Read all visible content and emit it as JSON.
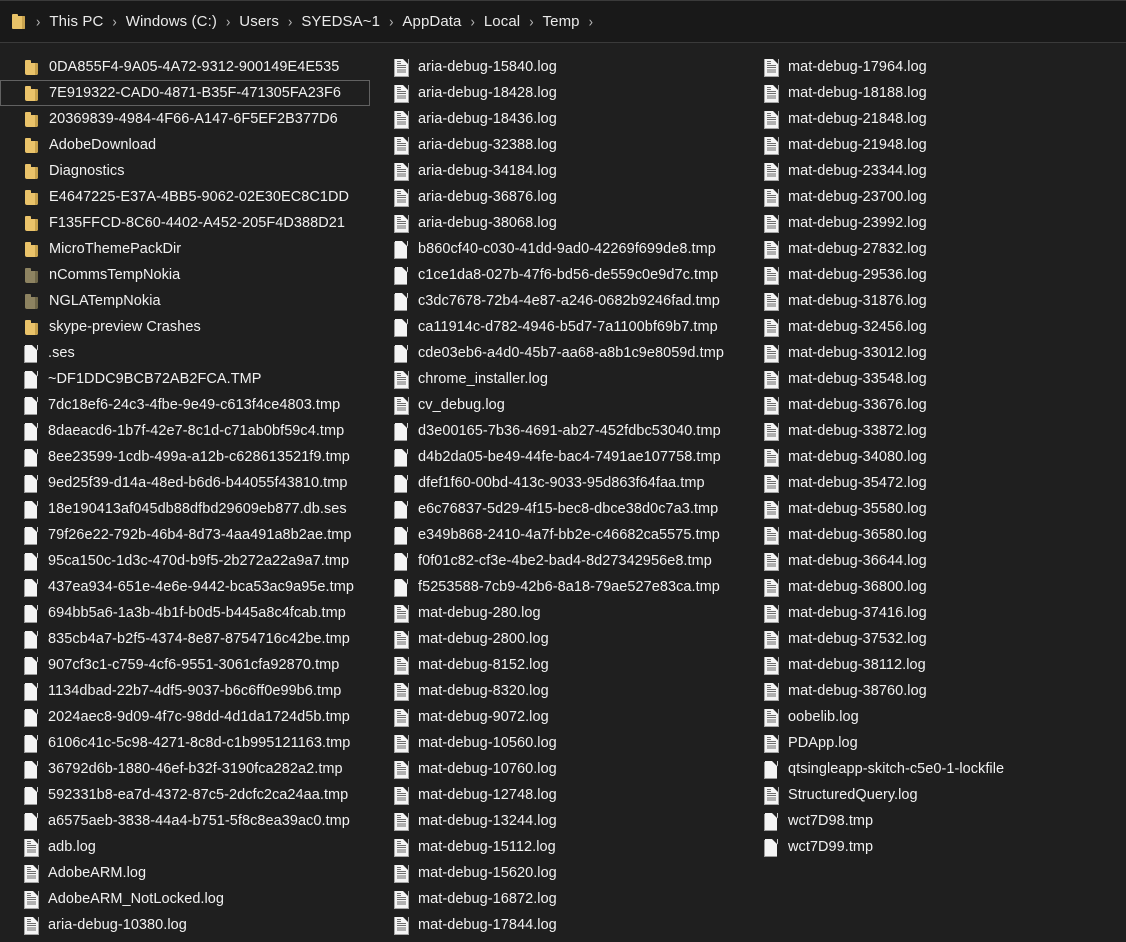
{
  "window": {
    "title": "Temp"
  },
  "addressbar": {
    "folder_icon": "folder-icon",
    "separator": "›",
    "crumbs": [
      "This PC",
      "Windows (C:)",
      "Users",
      "SYEDSA~1",
      "AppData",
      "Local",
      "Temp"
    ]
  },
  "colors": {
    "background": "#1f1f1f",
    "addressbar_background": "#191919",
    "text": "#f2f2f2",
    "folder_icon": "#eac36a",
    "folder_icon_dim": "#8d8361",
    "selection_border": "#616161",
    "file_icon": "#f4f4f4"
  },
  "files": [
    {
      "name": "0DA855F4-9A05-4A72-9312-900149E4E535",
      "type": "folder",
      "selected": false
    },
    {
      "name": "7E919322-CAD0-4871-B35F-471305FA23F6",
      "type": "folder",
      "selected": true
    },
    {
      "name": "20369839-4984-4F66-A147-6F5EF2B377D6",
      "type": "folder",
      "selected": false
    },
    {
      "name": "AdobeDownload",
      "type": "folder",
      "selected": false
    },
    {
      "name": "Diagnostics",
      "type": "folder",
      "selected": false
    },
    {
      "name": "E4647225-E37A-4BB5-9062-02E30EC8C1DD",
      "type": "folder",
      "selected": false
    },
    {
      "name": "F135FFCD-8C60-4402-A452-205F4D388D21",
      "type": "folder",
      "selected": false
    },
    {
      "name": "MicroThemePackDir",
      "type": "folder",
      "selected": false
    },
    {
      "name": "nCommsTempNokia",
      "type": "folder-dim",
      "selected": false
    },
    {
      "name": "NGLATempNokia",
      "type": "folder-dim",
      "selected": false
    },
    {
      "name": "skype-preview Crashes",
      "type": "folder",
      "selected": false
    },
    {
      "name": ".ses",
      "type": "file",
      "selected": false
    },
    {
      "name": "~DF1DDC9BCB72AB2FCA.TMP",
      "type": "file",
      "selected": false
    },
    {
      "name": "7dc18ef6-24c3-4fbe-9e49-c613f4ce4803.tmp",
      "type": "file",
      "selected": false
    },
    {
      "name": "8daeacd6-1b7f-42e7-8c1d-c71ab0bf59c4.tmp",
      "type": "file",
      "selected": false
    },
    {
      "name": "8ee23599-1cdb-499a-a12b-c628613521f9.tmp",
      "type": "file",
      "selected": false
    },
    {
      "name": "9ed25f39-d14a-48ed-b6d6-b44055f43810.tmp",
      "type": "file",
      "selected": false
    },
    {
      "name": "18e190413af045db88dfbd29609eb877.db.ses",
      "type": "file",
      "selected": false
    },
    {
      "name": "79f26e22-792b-46b4-8d73-4aa491a8b2ae.tmp",
      "type": "file",
      "selected": false
    },
    {
      "name": "95ca150c-1d3c-470d-b9f5-2b272a22a9a7.tmp",
      "type": "file",
      "selected": false
    },
    {
      "name": "437ea934-651e-4e6e-9442-bca53ac9a95e.tmp",
      "type": "file",
      "selected": false
    },
    {
      "name": "694bb5a6-1a3b-4b1f-b0d5-b445a8c4fcab.tmp",
      "type": "file",
      "selected": false
    },
    {
      "name": "835cb4a7-b2f5-4374-8e87-8754716c42be.tmp",
      "type": "file",
      "selected": false
    },
    {
      "name": "907cf3c1-c759-4cf6-9551-3061cfa92870.tmp",
      "type": "file",
      "selected": false
    },
    {
      "name": "1134dbad-22b7-4df5-9037-b6c6ff0e99b6.tmp",
      "type": "file",
      "selected": false
    },
    {
      "name": "2024aec8-9d09-4f7c-98dd-4d1da1724d5b.tmp",
      "type": "file",
      "selected": false
    },
    {
      "name": "6106c41c-5c98-4271-8c8d-c1b995121163.tmp",
      "type": "file",
      "selected": false
    },
    {
      "name": "36792d6b-1880-46ef-b32f-3190fca282a2.tmp",
      "type": "file",
      "selected": false
    },
    {
      "name": "592331b8-ea7d-4372-87c5-2dcfc2ca24aa.tmp",
      "type": "file",
      "selected": false
    },
    {
      "name": "a6575aeb-3838-44a4-b751-5f8c8ea39ac0.tmp",
      "type": "file",
      "selected": false
    },
    {
      "name": "adb.log",
      "type": "log",
      "selected": false
    },
    {
      "name": "AdobeARM.log",
      "type": "log",
      "selected": false
    },
    {
      "name": "AdobeARM_NotLocked.log",
      "type": "log",
      "selected": false
    },
    {
      "name": "aria-debug-10380.log",
      "type": "log",
      "selected": false
    },
    {
      "name": "aria-debug-15840.log",
      "type": "log",
      "selected": false
    },
    {
      "name": "aria-debug-18428.log",
      "type": "log",
      "selected": false
    },
    {
      "name": "aria-debug-18436.log",
      "type": "log",
      "selected": false
    },
    {
      "name": "aria-debug-32388.log",
      "type": "log",
      "selected": false
    },
    {
      "name": "aria-debug-34184.log",
      "type": "log",
      "selected": false
    },
    {
      "name": "aria-debug-36876.log",
      "type": "log",
      "selected": false
    },
    {
      "name": "aria-debug-38068.log",
      "type": "log",
      "selected": false
    },
    {
      "name": "b860cf40-c030-41dd-9ad0-42269f699de8.tmp",
      "type": "file",
      "selected": false
    },
    {
      "name": "c1ce1da8-027b-47f6-bd56-de559c0e9d7c.tmp",
      "type": "file",
      "selected": false
    },
    {
      "name": "c3dc7678-72b4-4e87-a246-0682b9246fad.tmp",
      "type": "file",
      "selected": false
    },
    {
      "name": "ca11914c-d782-4946-b5d7-7a1100bf69b7.tmp",
      "type": "file",
      "selected": false
    },
    {
      "name": "cde03eb6-a4d0-45b7-aa68-a8b1c9e8059d.tmp",
      "type": "file",
      "selected": false
    },
    {
      "name": "chrome_installer.log",
      "type": "log",
      "selected": false
    },
    {
      "name": "cv_debug.log",
      "type": "log",
      "selected": false
    },
    {
      "name": "d3e00165-7b36-4691-ab27-452fdbc53040.tmp",
      "type": "file",
      "selected": false
    },
    {
      "name": "d4b2da05-be49-44fe-bac4-7491ae107758.tmp",
      "type": "file",
      "selected": false
    },
    {
      "name": "dfef1f60-00bd-413c-9033-95d863f64faa.tmp",
      "type": "file",
      "selected": false
    },
    {
      "name": "e6c76837-5d29-4f15-bec8-dbce38d0c7a3.tmp",
      "type": "file",
      "selected": false
    },
    {
      "name": "e349b868-2410-4a7f-bb2e-c46682ca5575.tmp",
      "type": "file",
      "selected": false
    },
    {
      "name": "f0f01c82-cf3e-4be2-bad4-8d27342956e8.tmp",
      "type": "file",
      "selected": false
    },
    {
      "name": "f5253588-7cb9-42b6-8a18-79ae527e83ca.tmp",
      "type": "file",
      "selected": false
    },
    {
      "name": "mat-debug-280.log",
      "type": "log",
      "selected": false
    },
    {
      "name": "mat-debug-2800.log",
      "type": "log",
      "selected": false
    },
    {
      "name": "mat-debug-8152.log",
      "type": "log",
      "selected": false
    },
    {
      "name": "mat-debug-8320.log",
      "type": "log",
      "selected": false
    },
    {
      "name": "mat-debug-9072.log",
      "type": "log",
      "selected": false
    },
    {
      "name": "mat-debug-10560.log",
      "type": "log",
      "selected": false
    },
    {
      "name": "mat-debug-10760.log",
      "type": "log",
      "selected": false
    },
    {
      "name": "mat-debug-12748.log",
      "type": "log",
      "selected": false
    },
    {
      "name": "mat-debug-13244.log",
      "type": "log",
      "selected": false
    },
    {
      "name": "mat-debug-15112.log",
      "type": "log",
      "selected": false
    },
    {
      "name": "mat-debug-15620.log",
      "type": "log",
      "selected": false
    },
    {
      "name": "mat-debug-16872.log",
      "type": "log",
      "selected": false
    },
    {
      "name": "mat-debug-17844.log",
      "type": "log",
      "selected": false
    },
    {
      "name": "mat-debug-17964.log",
      "type": "log",
      "selected": false
    },
    {
      "name": "mat-debug-18188.log",
      "type": "log",
      "selected": false
    },
    {
      "name": "mat-debug-21848.log",
      "type": "log",
      "selected": false
    },
    {
      "name": "mat-debug-21948.log",
      "type": "log",
      "selected": false
    },
    {
      "name": "mat-debug-23344.log",
      "type": "log",
      "selected": false
    },
    {
      "name": "mat-debug-23700.log",
      "type": "log",
      "selected": false
    },
    {
      "name": "mat-debug-23992.log",
      "type": "log",
      "selected": false
    },
    {
      "name": "mat-debug-27832.log",
      "type": "log",
      "selected": false
    },
    {
      "name": "mat-debug-29536.log",
      "type": "log",
      "selected": false
    },
    {
      "name": "mat-debug-31876.log",
      "type": "log",
      "selected": false
    },
    {
      "name": "mat-debug-32456.log",
      "type": "log",
      "selected": false
    },
    {
      "name": "mat-debug-33012.log",
      "type": "log",
      "selected": false
    },
    {
      "name": "mat-debug-33548.log",
      "type": "log",
      "selected": false
    },
    {
      "name": "mat-debug-33676.log",
      "type": "log",
      "selected": false
    },
    {
      "name": "mat-debug-33872.log",
      "type": "log",
      "selected": false
    },
    {
      "name": "mat-debug-34080.log",
      "type": "log",
      "selected": false
    },
    {
      "name": "mat-debug-35472.log",
      "type": "log",
      "selected": false
    },
    {
      "name": "mat-debug-35580.log",
      "type": "log",
      "selected": false
    },
    {
      "name": "mat-debug-36580.log",
      "type": "log",
      "selected": false
    },
    {
      "name": "mat-debug-36644.log",
      "type": "log",
      "selected": false
    },
    {
      "name": "mat-debug-36800.log",
      "type": "log",
      "selected": false
    },
    {
      "name": "mat-debug-37416.log",
      "type": "log",
      "selected": false
    },
    {
      "name": "mat-debug-37532.log",
      "type": "log",
      "selected": false
    },
    {
      "name": "mat-debug-38112.log",
      "type": "log",
      "selected": false
    },
    {
      "name": "mat-debug-38760.log",
      "type": "log",
      "selected": false
    },
    {
      "name": "oobelib.log",
      "type": "log",
      "selected": false
    },
    {
      "name": "PDApp.log",
      "type": "log",
      "selected": false
    },
    {
      "name": "qtsingleapp-skitch-c5e0-1-lockfile",
      "type": "file",
      "selected": false
    },
    {
      "name": "StructuredQuery.log",
      "type": "log",
      "selected": false
    },
    {
      "name": "wct7D98.tmp",
      "type": "file",
      "selected": false
    },
    {
      "name": "wct7D99.tmp",
      "type": "file",
      "selected": false
    }
  ]
}
